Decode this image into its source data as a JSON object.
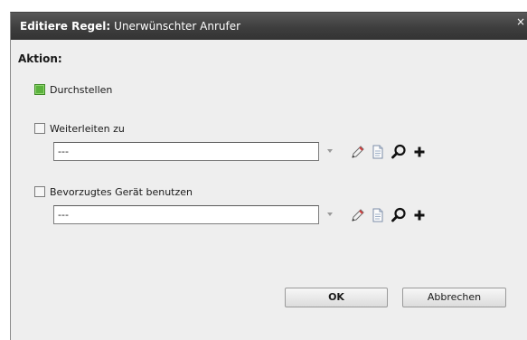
{
  "dialog": {
    "title_bold": "Editiere Regel:",
    "title_subject": "Unerwünschter Anrufer",
    "close_label": "×"
  },
  "section": {
    "title": "Aktion:"
  },
  "options": [
    {
      "label": "Durchstellen",
      "checked": true
    },
    {
      "label": "Weiterleiten zu",
      "checked": false,
      "combo_value": "---"
    },
    {
      "label": "Bevorzugtes Gerät benutzen",
      "checked": false,
      "combo_value": "---"
    }
  ],
  "buttons": {
    "ok_label": "OK",
    "cancel_label": "Abbrechen"
  },
  "icons": [
    "pencil-icon",
    "document-icon",
    "magnifier-icon",
    "plus-icon"
  ],
  "colors": {
    "titlebar": "#3e3e3e",
    "checked_green": "#5bb23d",
    "dialog_bg": "#eeeeee"
  }
}
